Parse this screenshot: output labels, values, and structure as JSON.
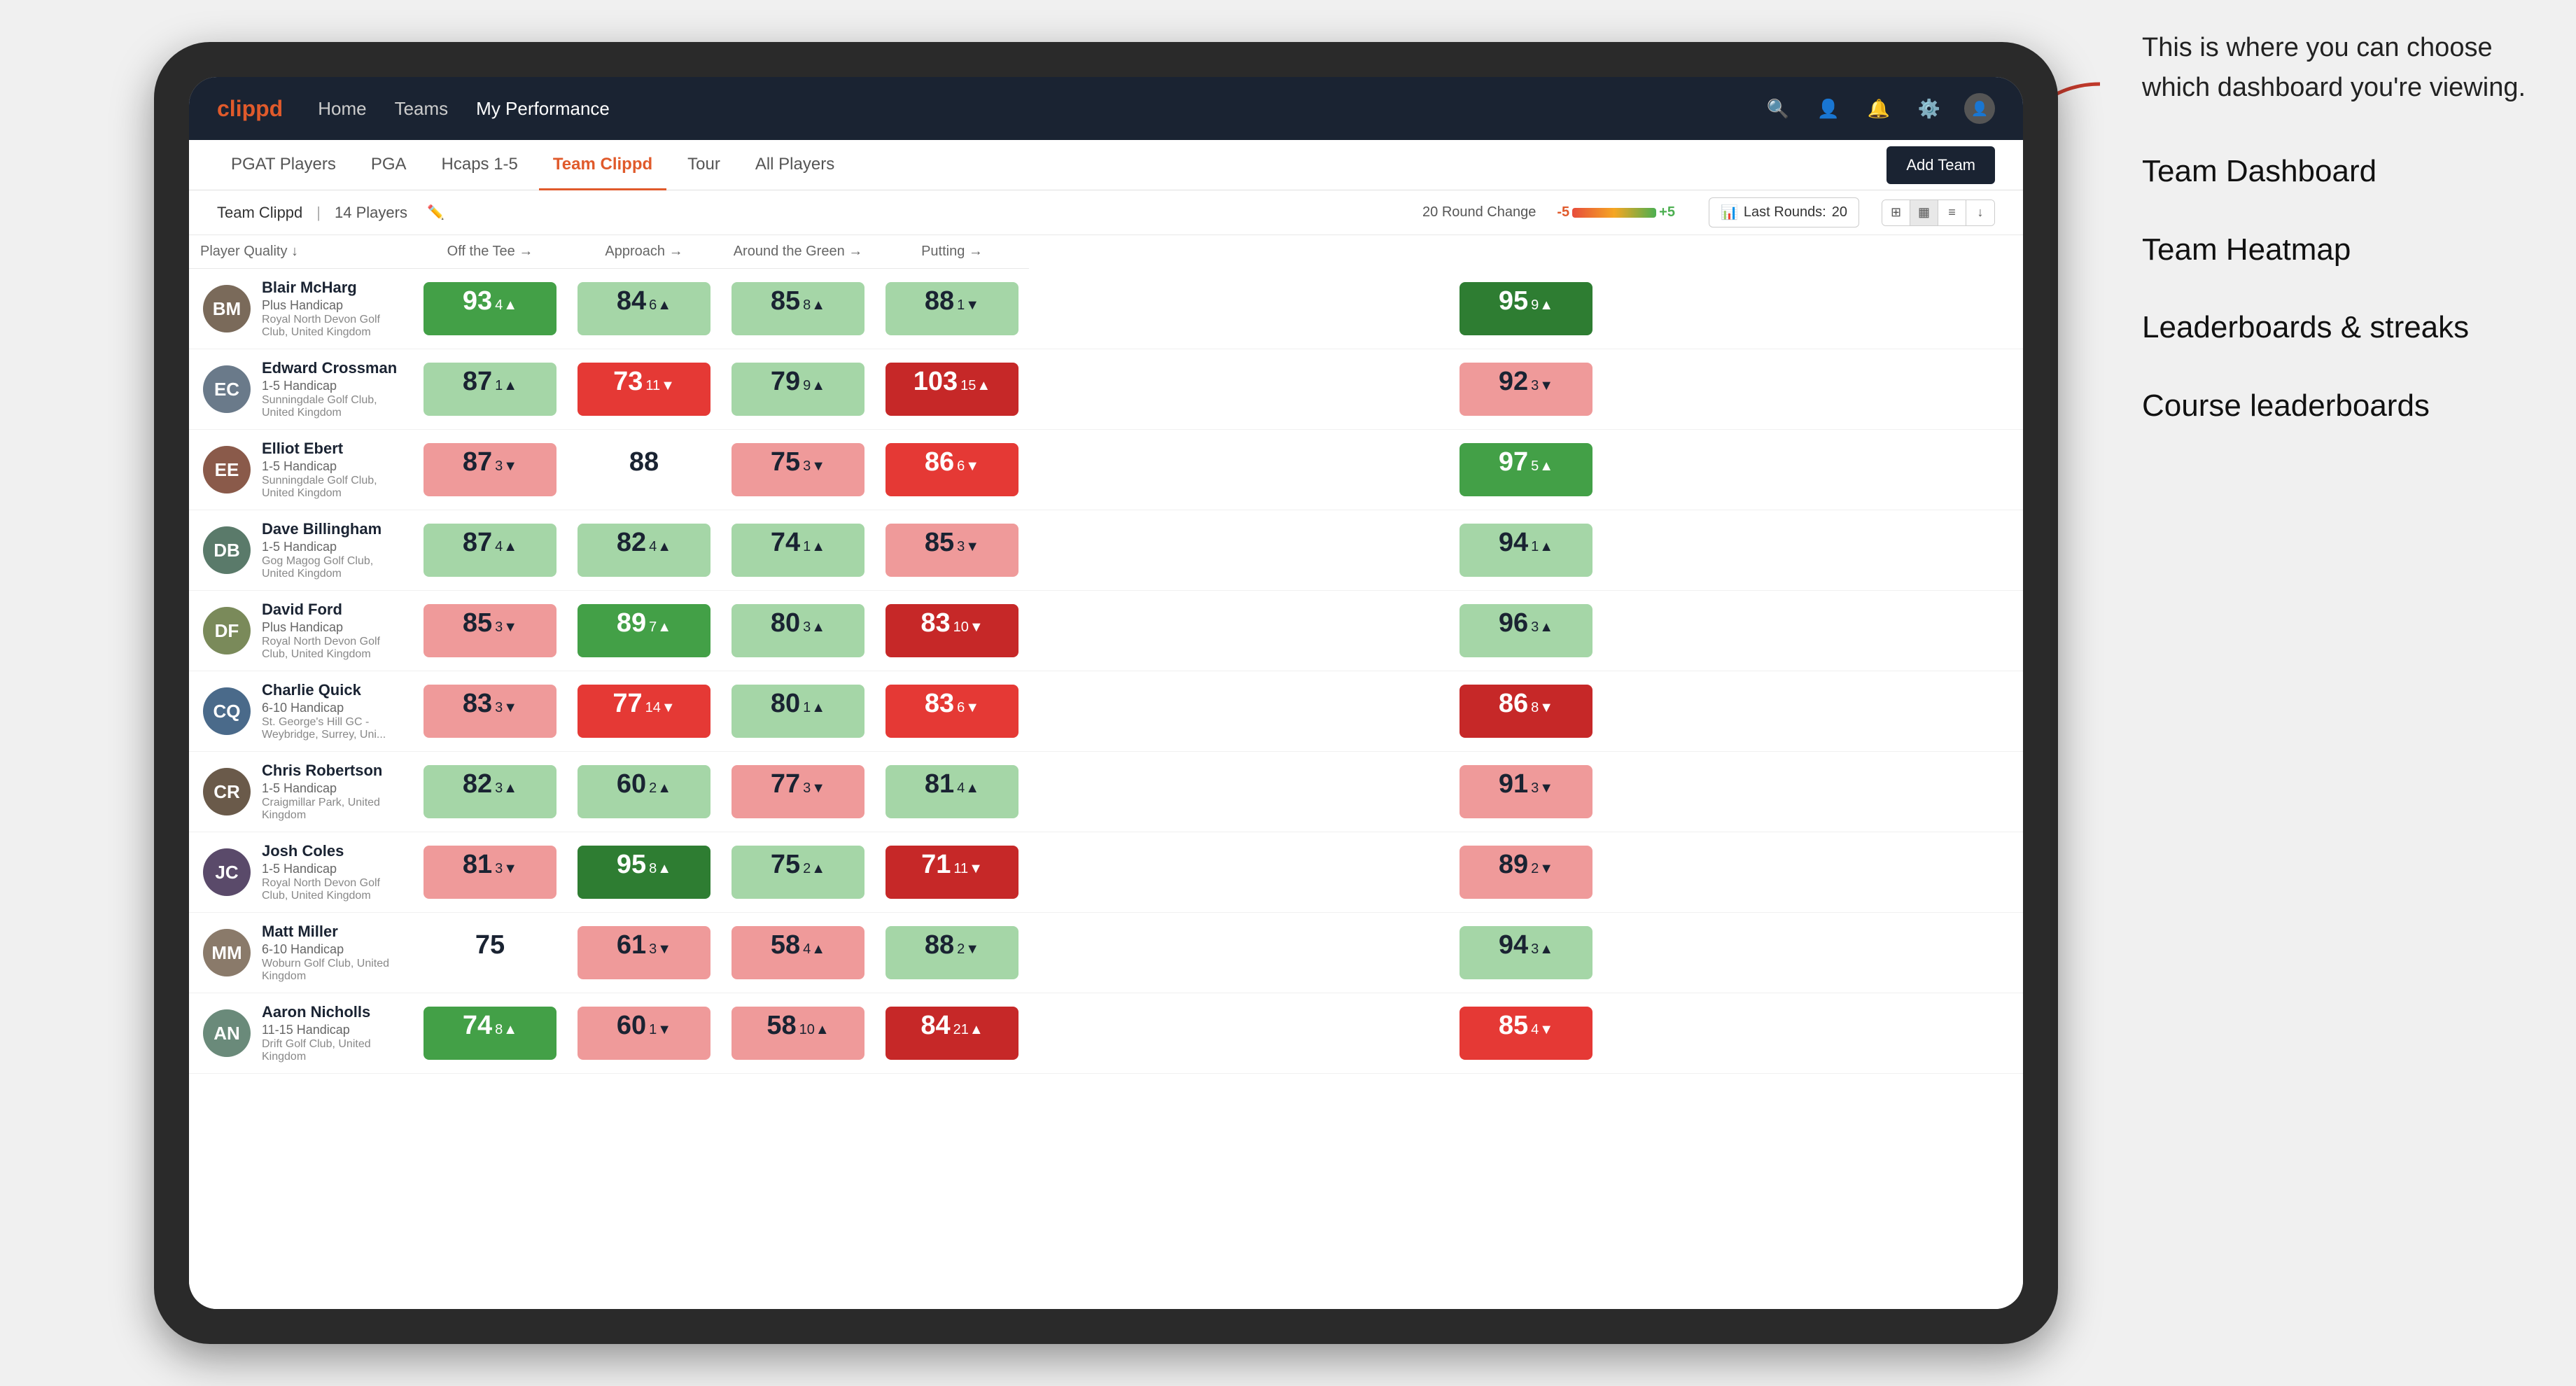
{
  "annotation": {
    "intro": "This is where you can choose which dashboard you're viewing.",
    "items": [
      "Team Dashboard",
      "Team Heatmap",
      "Leaderboards & streaks",
      "Course leaderboards"
    ]
  },
  "nav": {
    "logo": "clippd",
    "items": [
      "Home",
      "Teams",
      "My Performance"
    ],
    "active": "My Performance"
  },
  "sub_tabs": {
    "tabs": [
      "PGAT Players",
      "PGA",
      "Hcaps 1-5",
      "Team Clippd",
      "Tour",
      "All Players"
    ],
    "active": "Team Clippd",
    "add_button": "Add Team"
  },
  "team_bar": {
    "name": "Team Clippd",
    "separator": "|",
    "count": "14 Players",
    "round_change_label": "20 Round Change",
    "scale_neg": "-5",
    "scale_pos": "+5",
    "last_rounds_label": "Last Rounds:",
    "last_rounds_value": "20"
  },
  "table": {
    "columns": [
      "Player Quality ↓",
      "Off the Tee →",
      "Approach →",
      "Around the Green →",
      "Putting →"
    ],
    "players": [
      {
        "name": "Blair McHarg",
        "handicap": "Plus Handicap",
        "club": "Royal North Devon Golf Club, United Kingdom",
        "initials": "BM",
        "color": "#7a6a5a",
        "metrics": [
          {
            "value": "93",
            "delta": "4",
            "dir": "up",
            "bg": "bg-green-medium"
          },
          {
            "value": "84",
            "delta": "6",
            "dir": "up",
            "bg": "bg-green-light"
          },
          {
            "value": "85",
            "delta": "8",
            "dir": "up",
            "bg": "bg-green-light"
          },
          {
            "value": "88",
            "delta": "1",
            "dir": "down",
            "bg": "bg-green-light"
          },
          {
            "value": "95",
            "delta": "9",
            "dir": "up",
            "bg": "bg-green-strong"
          }
        ]
      },
      {
        "name": "Edward Crossman",
        "handicap": "1-5 Handicap",
        "club": "Sunningdale Golf Club, United Kingdom",
        "initials": "EC",
        "color": "#6a7a8a",
        "metrics": [
          {
            "value": "87",
            "delta": "1",
            "dir": "up",
            "bg": "bg-green-light"
          },
          {
            "value": "73",
            "delta": "11",
            "dir": "down",
            "bg": "bg-red-medium"
          },
          {
            "value": "79",
            "delta": "9",
            "dir": "up",
            "bg": "bg-green-light"
          },
          {
            "value": "103",
            "delta": "15",
            "dir": "up",
            "bg": "bg-red-strong"
          },
          {
            "value": "92",
            "delta": "3",
            "dir": "down",
            "bg": "bg-red-light"
          }
        ]
      },
      {
        "name": "Elliot Ebert",
        "handicap": "1-5 Handicap",
        "club": "Sunningdale Golf Club, United Kingdom",
        "initials": "EE",
        "color": "#8a5a4a",
        "metrics": [
          {
            "value": "87",
            "delta": "3",
            "dir": "down",
            "bg": "bg-red-light"
          },
          {
            "value": "88",
            "delta": "",
            "dir": "",
            "bg": "bg-white"
          },
          {
            "value": "75",
            "delta": "3",
            "dir": "down",
            "bg": "bg-red-light"
          },
          {
            "value": "86",
            "delta": "6",
            "dir": "down",
            "bg": "bg-red-medium"
          },
          {
            "value": "97",
            "delta": "5",
            "dir": "up",
            "bg": "bg-green-medium"
          }
        ]
      },
      {
        "name": "Dave Billingham",
        "handicap": "1-5 Handicap",
        "club": "Gog Magog Golf Club, United Kingdom",
        "initials": "DB",
        "color": "#5a7a6a",
        "metrics": [
          {
            "value": "87",
            "delta": "4",
            "dir": "up",
            "bg": "bg-green-light"
          },
          {
            "value": "82",
            "delta": "4",
            "dir": "up",
            "bg": "bg-green-light"
          },
          {
            "value": "74",
            "delta": "1",
            "dir": "up",
            "bg": "bg-green-light"
          },
          {
            "value": "85",
            "delta": "3",
            "dir": "down",
            "bg": "bg-red-light"
          },
          {
            "value": "94",
            "delta": "1",
            "dir": "up",
            "bg": "bg-green-light"
          }
        ]
      },
      {
        "name": "David Ford",
        "handicap": "Plus Handicap",
        "club": "Royal North Devon Golf Club, United Kingdom",
        "initials": "DF",
        "color": "#7a8a5a",
        "metrics": [
          {
            "value": "85",
            "delta": "3",
            "dir": "down",
            "bg": "bg-red-light"
          },
          {
            "value": "89",
            "delta": "7",
            "dir": "up",
            "bg": "bg-green-medium"
          },
          {
            "value": "80",
            "delta": "3",
            "dir": "up",
            "bg": "bg-green-light"
          },
          {
            "value": "83",
            "delta": "10",
            "dir": "down",
            "bg": "bg-red-strong"
          },
          {
            "value": "96",
            "delta": "3",
            "dir": "up",
            "bg": "bg-green-light"
          }
        ]
      },
      {
        "name": "Charlie Quick",
        "handicap": "6-10 Handicap",
        "club": "St. George's Hill GC - Weybridge, Surrey, Uni...",
        "initials": "CQ",
        "color": "#4a6a8a",
        "metrics": [
          {
            "value": "83",
            "delta": "3",
            "dir": "down",
            "bg": "bg-red-light"
          },
          {
            "value": "77",
            "delta": "14",
            "dir": "down",
            "bg": "bg-red-medium"
          },
          {
            "value": "80",
            "delta": "1",
            "dir": "up",
            "bg": "bg-green-light"
          },
          {
            "value": "83",
            "delta": "6",
            "dir": "down",
            "bg": "bg-red-medium"
          },
          {
            "value": "86",
            "delta": "8",
            "dir": "down",
            "bg": "bg-red-strong"
          }
        ]
      },
      {
        "name": "Chris Robertson",
        "handicap": "1-5 Handicap",
        "club": "Craigmillar Park, United Kingdom",
        "initials": "CR",
        "color": "#6a5a4a",
        "metrics": [
          {
            "value": "82",
            "delta": "3",
            "dir": "up",
            "bg": "bg-green-light"
          },
          {
            "value": "60",
            "delta": "2",
            "dir": "up",
            "bg": "bg-green-light"
          },
          {
            "value": "77",
            "delta": "3",
            "dir": "down",
            "bg": "bg-red-light"
          },
          {
            "value": "81",
            "delta": "4",
            "dir": "up",
            "bg": "bg-green-light"
          },
          {
            "value": "91",
            "delta": "3",
            "dir": "down",
            "bg": "bg-red-light"
          }
        ]
      },
      {
        "name": "Josh Coles",
        "handicap": "1-5 Handicap",
        "club": "Royal North Devon Golf Club, United Kingdom",
        "initials": "JC",
        "color": "#5a4a6a",
        "metrics": [
          {
            "value": "81",
            "delta": "3",
            "dir": "down",
            "bg": "bg-red-light"
          },
          {
            "value": "95",
            "delta": "8",
            "dir": "up",
            "bg": "bg-green-strong"
          },
          {
            "value": "75",
            "delta": "2",
            "dir": "up",
            "bg": "bg-green-light"
          },
          {
            "value": "71",
            "delta": "11",
            "dir": "down",
            "bg": "bg-red-strong"
          },
          {
            "value": "89",
            "delta": "2",
            "dir": "down",
            "bg": "bg-red-light"
          }
        ]
      },
      {
        "name": "Matt Miller",
        "handicap": "6-10 Handicap",
        "club": "Woburn Golf Club, United Kingdom",
        "initials": "MM",
        "color": "#8a7a6a",
        "metrics": [
          {
            "value": "75",
            "delta": "",
            "dir": "",
            "bg": "bg-white"
          },
          {
            "value": "61",
            "delta": "3",
            "dir": "down",
            "bg": "bg-red-light"
          },
          {
            "value": "58",
            "delta": "4",
            "dir": "up",
            "bg": "bg-red-light"
          },
          {
            "value": "88",
            "delta": "2",
            "dir": "down",
            "bg": "bg-green-light"
          },
          {
            "value": "94",
            "delta": "3",
            "dir": "up",
            "bg": "bg-green-light"
          }
        ]
      },
      {
        "name": "Aaron Nicholls",
        "handicap": "11-15 Handicap",
        "club": "Drift Golf Club, United Kingdom",
        "initials": "AN",
        "color": "#6a8a7a",
        "metrics": [
          {
            "value": "74",
            "delta": "8",
            "dir": "up",
            "bg": "bg-green-medium"
          },
          {
            "value": "60",
            "delta": "1",
            "dir": "down",
            "bg": "bg-red-light"
          },
          {
            "value": "58",
            "delta": "10",
            "dir": "up",
            "bg": "bg-red-light"
          },
          {
            "value": "84",
            "delta": "21",
            "dir": "up",
            "bg": "bg-red-strong"
          },
          {
            "value": "85",
            "delta": "4",
            "dir": "down",
            "bg": "bg-red-medium"
          }
        ]
      }
    ]
  }
}
